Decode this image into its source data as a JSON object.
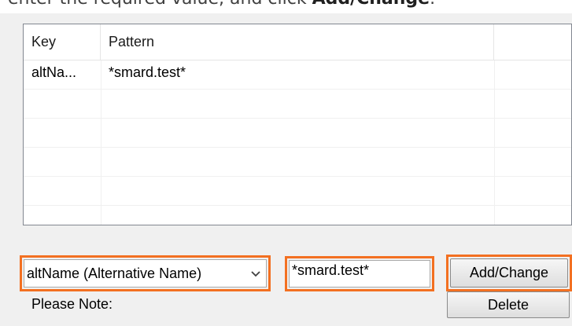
{
  "intro": {
    "prefix": "enter the required value, and click ",
    "bold": "Add/Change",
    "suffix": "."
  },
  "list": {
    "columns": [
      "Key",
      "Pattern",
      ""
    ],
    "rows": [
      {
        "key": "altNa...",
        "pattern": "*smard.test*"
      },
      {
        "key": "",
        "pattern": ""
      },
      {
        "key": "",
        "pattern": ""
      },
      {
        "key": "",
        "pattern": ""
      },
      {
        "key": "",
        "pattern": ""
      },
      {
        "key": "",
        "pattern": ""
      }
    ]
  },
  "key_select": {
    "value": "altName (Alternative Name)",
    "arrow_icon": "chevron-down-icon"
  },
  "pattern_input": {
    "value": "*smard.test*"
  },
  "buttons": {
    "add_change": "Add/Change",
    "delete": "Delete"
  },
  "note": {
    "label": "Please Note:"
  },
  "colors": {
    "highlight": "#f37021",
    "dialog_bg": "#f0f0f0"
  }
}
